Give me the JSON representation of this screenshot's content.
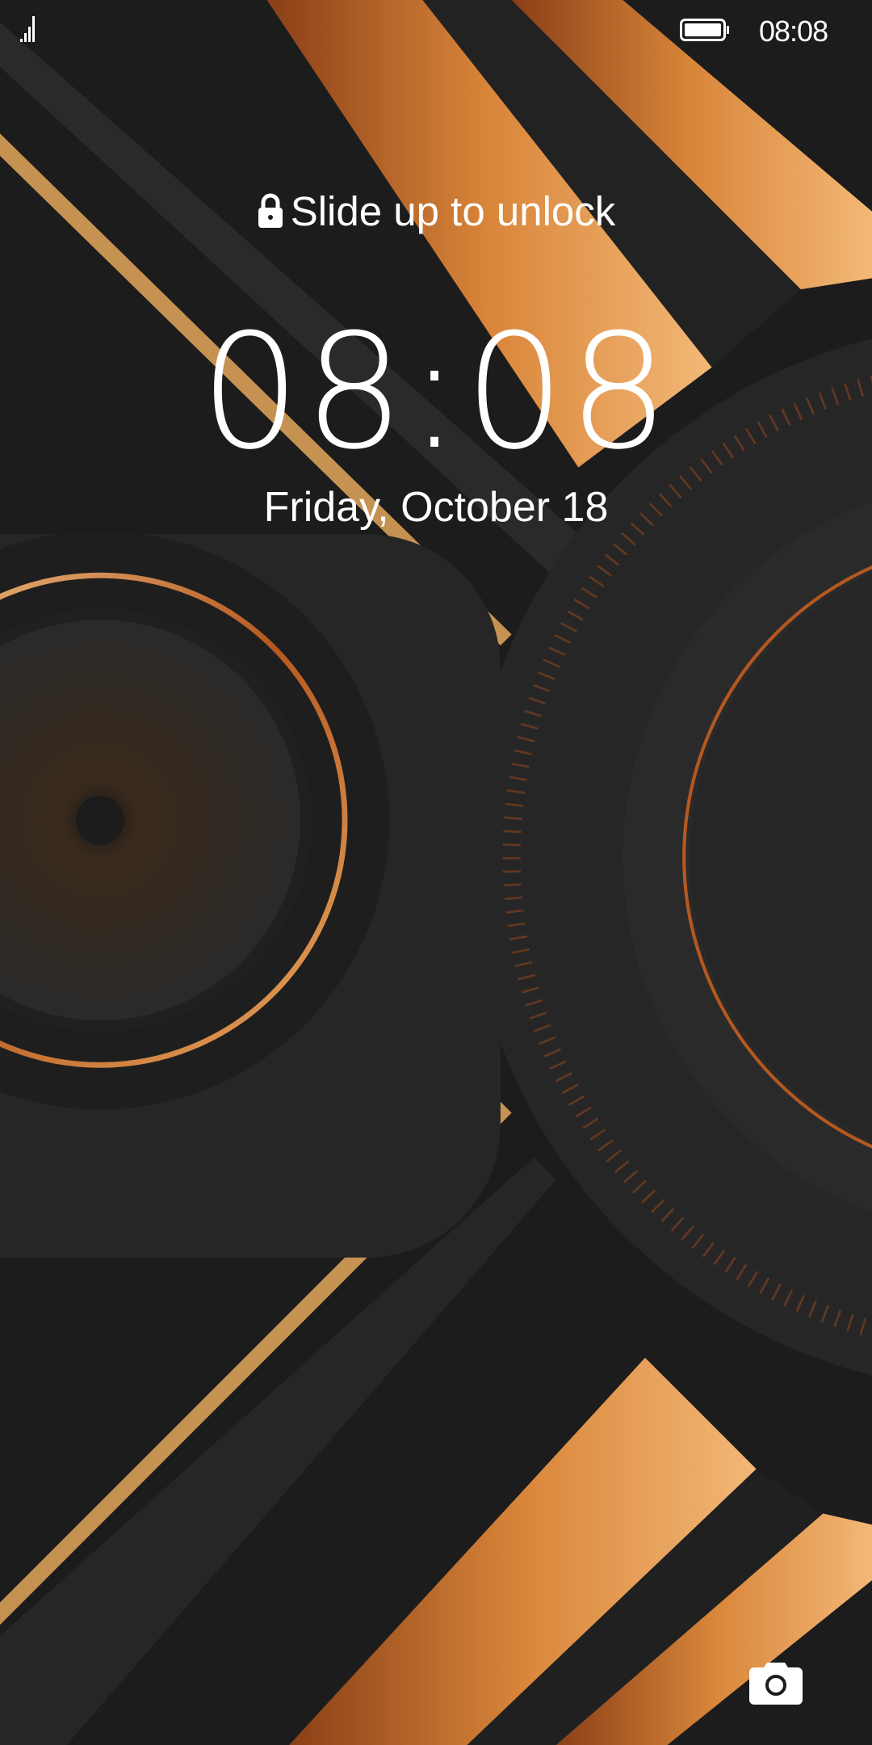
{
  "status_bar": {
    "time": "08:08",
    "signal_icon": "signal-bars-icon",
    "battery_icon": "battery-full-icon"
  },
  "lock_screen": {
    "unlock_hint": "Slide up to unlock",
    "lock_icon": "lock-icon",
    "clock": "08:08",
    "date": "Friday, October 18",
    "camera_icon": "camera-icon"
  },
  "colors": {
    "accent": "#e39a45",
    "accent_dark": "#b8612a",
    "background": "#1c1c1c"
  }
}
